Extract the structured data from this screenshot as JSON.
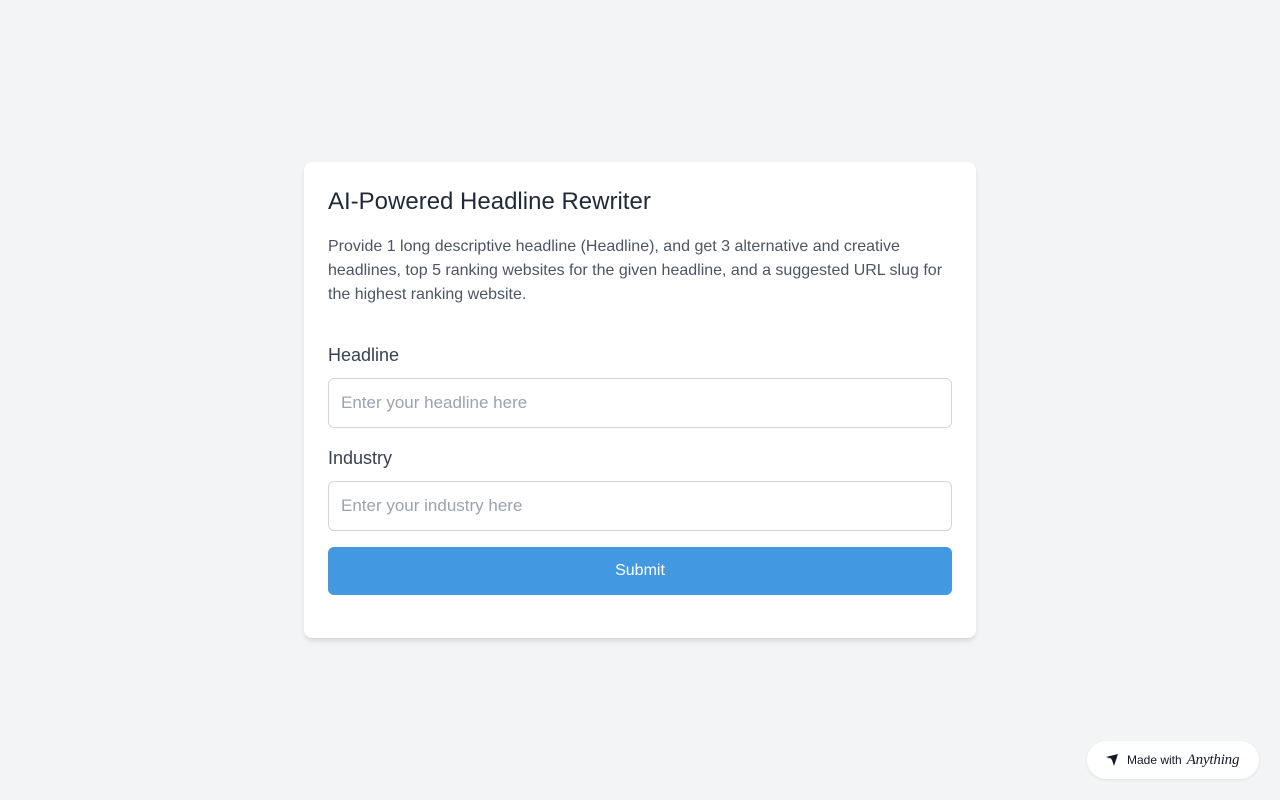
{
  "form": {
    "title": "AI-Powered Headline Rewriter",
    "description": "Provide 1 long descriptive headline (Headline), and get 3 alternative and creative headlines, top 5 ranking websites for the given headline, and a suggested URL slug for the highest ranking website.",
    "headline": {
      "label": "Headline",
      "value": "",
      "placeholder": "Enter your headline here"
    },
    "industry": {
      "label": "Industry",
      "value": "",
      "placeholder": "Enter your industry here"
    },
    "submit_label": "Submit"
  },
  "badge": {
    "text": "Made with",
    "brand": "Anything",
    "icon": "anything-logo-icon"
  },
  "colors": {
    "background": "#f3f4f6",
    "accent": "#4299e1",
    "card": "#ffffff"
  }
}
